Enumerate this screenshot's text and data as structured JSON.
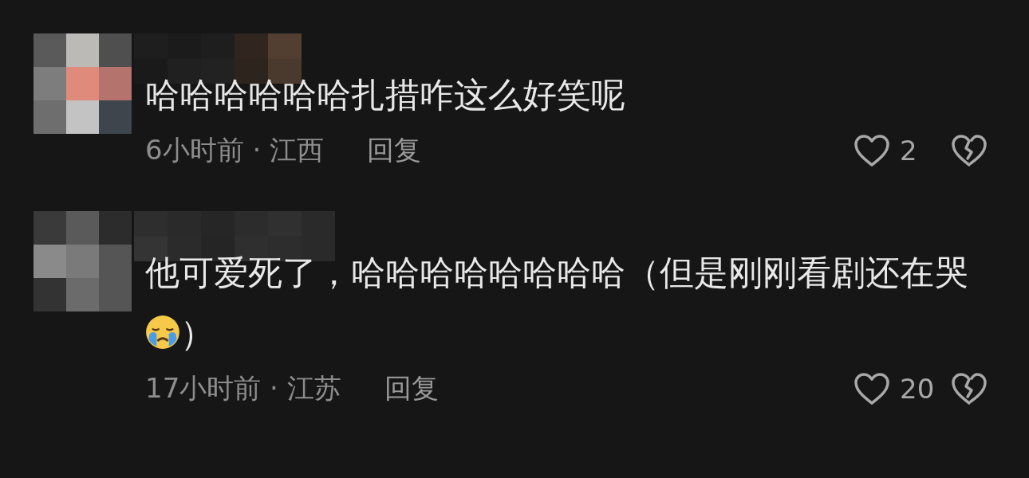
{
  "comments": [
    {
      "text_parts": [
        {
          "kind": "text",
          "text": "哈哈哈哈哈哈扎措咋这么好笑呢"
        }
      ],
      "time_location": "6小时前 · 江西",
      "reply": "回复",
      "likes": "2"
    },
    {
      "text_parts": [
        {
          "kind": "text",
          "text": "他可爱死了，哈哈哈哈哈哈哈哈（但是刚刚看剧还在哭"
        },
        {
          "kind": "emoji"
        },
        {
          "kind": "text",
          "text": "）"
        }
      ],
      "time_location": "17小时前 · 江苏",
      "reply": "回复",
      "likes": "20"
    }
  ]
}
